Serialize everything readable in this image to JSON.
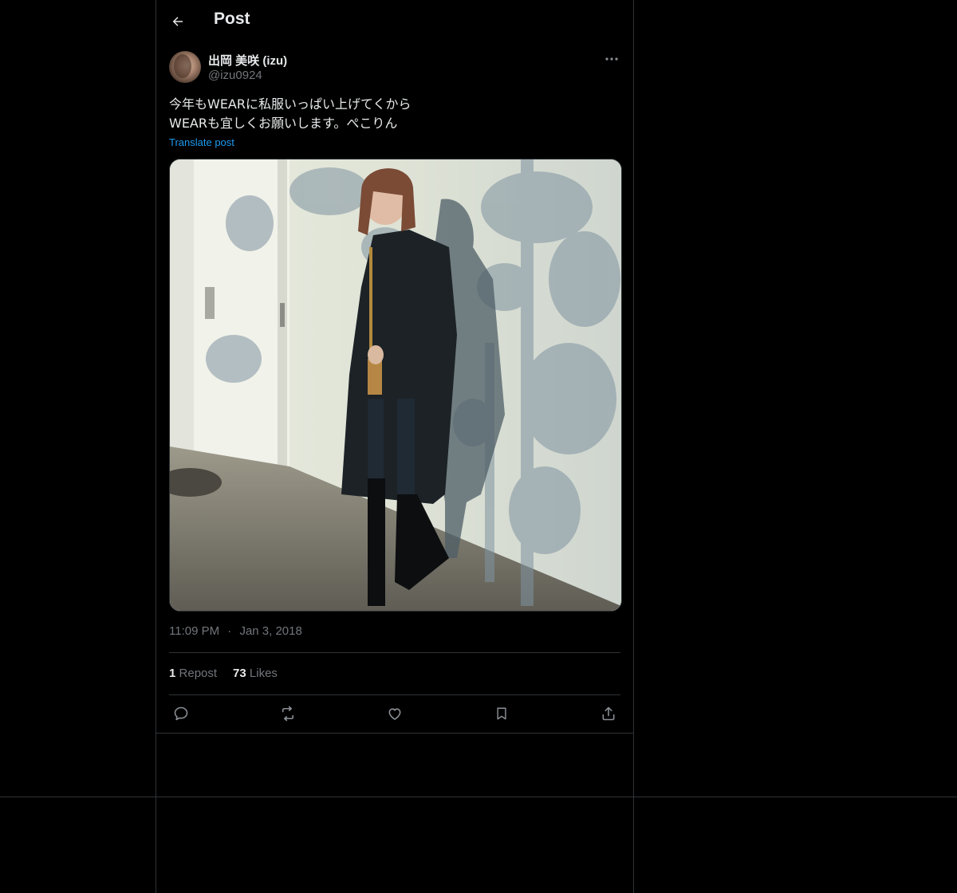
{
  "header": {
    "title": "Post",
    "back_icon": "arrow-left-icon"
  },
  "author": {
    "name": "出岡 美咲 (izu)",
    "handle": "@izu0924"
  },
  "post": {
    "text_lines": [
      "今年もWEARに私服いっぱい上げてくから",
      "WEARも宜しくお願いします。ぺこりん"
    ],
    "translate_label": "Translate post",
    "time": "11:09 PM",
    "separator": "·",
    "date": "Jan 3, 2018"
  },
  "stats": {
    "reposts_count": "1",
    "reposts_label": "Repost",
    "likes_count": "73",
    "likes_label": "Likes"
  },
  "actions": [
    "reply-icon",
    "repost-icon",
    "like-icon",
    "bookmark-icon",
    "share-icon"
  ],
  "colors": {
    "background": "#000000",
    "text": "#e7e9ea",
    "secondary": "#71767b",
    "link": "#1d9bf0",
    "border": "#2f3336"
  }
}
